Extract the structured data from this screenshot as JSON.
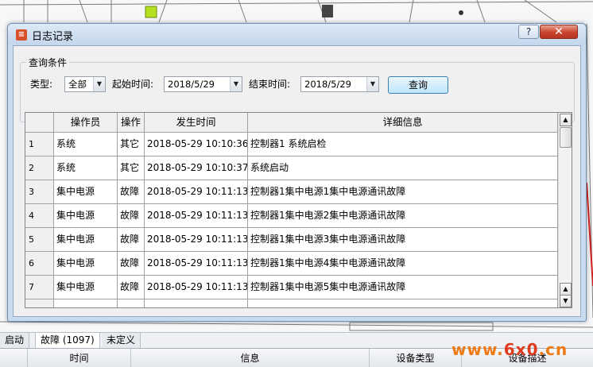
{
  "dialog": {
    "title": "日志记录",
    "help_label": "?",
    "close_label": "✕"
  },
  "query": {
    "group_title": "查询条件",
    "type_label": "类型:",
    "type_value": "全部",
    "start_label": "起始时间:",
    "start_value": "2018/5/29",
    "end_label": "结束时间:",
    "end_value": "2018/5/29",
    "search_button": "查询"
  },
  "table": {
    "columns": [
      "",
      "操作员",
      "操作",
      "发生时间",
      "详细信息"
    ],
    "rows": [
      {
        "num": "1",
        "operator": "系统",
        "action": "其它",
        "time": "2018-05-29 10:10:36",
        "detail": "控制器1 系统启检"
      },
      {
        "num": "2",
        "operator": "系统",
        "action": "其它",
        "time": "2018-05-29 10:10:37",
        "detail": "系统启动"
      },
      {
        "num": "3",
        "operator": "集中电源",
        "action": "故障",
        "time": "2018-05-29 10:11:13",
        "detail": "控制器1集中电源1集中电源通讯故障"
      },
      {
        "num": "4",
        "operator": "集中电源",
        "action": "故障",
        "time": "2018-05-29 10:11:13",
        "detail": "控制器1集中电源2集中电源通讯故障"
      },
      {
        "num": "5",
        "operator": "集中电源",
        "action": "故障",
        "time": "2018-05-29 10:11:13",
        "detail": "控制器1集中电源3集中电源通讯故障"
      },
      {
        "num": "6",
        "operator": "集中电源",
        "action": "故障",
        "time": "2018-05-29 10:11:13",
        "detail": "控制器1集中电源4集中电源通讯故障"
      },
      {
        "num": "7",
        "operator": "集中电源",
        "action": "故障",
        "time": "2018-05-29 10:11:13",
        "detail": "控制器1集中电源5集中电源通讯故障"
      }
    ]
  },
  "app": {
    "tabs": [
      "启动",
      "故障 (1097)",
      "未定义"
    ],
    "header_columns": [
      "时间",
      "信息",
      "设备类型",
      "设备描述"
    ],
    "watermark_a": "www.",
    "watermark_b": "6x0",
    "watermark_c": ".cn"
  },
  "colors": {
    "titlebar": "#c9dcef",
    "close_button": "#c8432c",
    "query_button": "#bee6fd",
    "watermark": "#f07a14"
  }
}
